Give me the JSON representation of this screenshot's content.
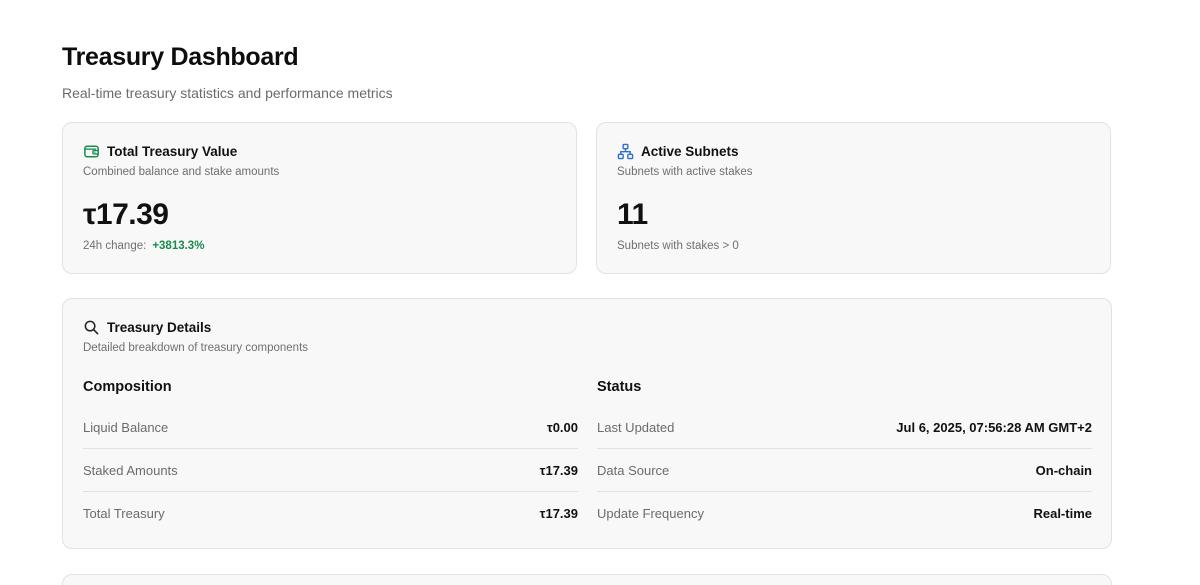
{
  "header": {
    "title": "Treasury Dashboard",
    "subtitle": "Real-time treasury statistics and performance metrics"
  },
  "total_treasury": {
    "icon": "wallet-icon",
    "title": "Total Treasury Value",
    "description": "Combined balance and stake amounts",
    "value": "τ17.39",
    "change_label": "24h change:",
    "change_value": "+3813.3%"
  },
  "active_subnets": {
    "icon": "network-icon",
    "title": "Active Subnets",
    "description": "Subnets with active stakes",
    "value": "11",
    "footnote": "Subnets with stakes > 0"
  },
  "details": {
    "icon": "search-icon",
    "title": "Treasury Details",
    "description": "Detailed breakdown of treasury components",
    "composition": {
      "title": "Composition",
      "rows": [
        {
          "label": "Liquid Balance",
          "value": "τ0.00"
        },
        {
          "label": "Staked Amounts",
          "value": "τ17.39"
        },
        {
          "label": "Total Treasury",
          "value": "τ17.39"
        }
      ]
    },
    "status": {
      "title": "Status",
      "rows": [
        {
          "label": "Last Updated",
          "value": "Jul 6, 2025, 07:56:28 AM GMT+2"
        },
        {
          "label": "Data Source",
          "value": "On-chain"
        },
        {
          "label": "Update Frequency",
          "value": "Real-time"
        }
      ]
    }
  },
  "colors": {
    "positive": "#1a8a4e",
    "wallet_icon": "#1a8a4e",
    "network_icon": "#2f6fd6"
  }
}
